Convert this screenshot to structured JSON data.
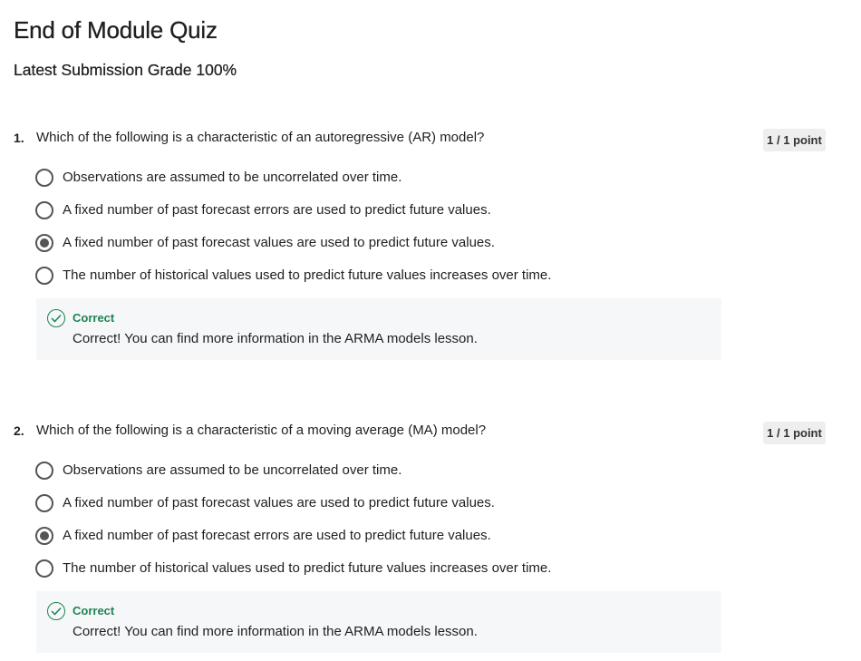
{
  "quiz": {
    "title": "End of Module Quiz",
    "grade": "Latest Submission Grade 100%"
  },
  "questions": [
    {
      "number": "1.",
      "text": "Which of the following is a characteristic of an autoregressive (AR) model?",
      "points": "1 / 1 point",
      "options": [
        {
          "label": "Observations are assumed to be uncorrelated over time.",
          "selected": false
        },
        {
          "label": "A fixed number of past forecast errors are used to predict future values.",
          "selected": false
        },
        {
          "label": "A fixed number of past forecast values are used to predict future values.",
          "selected": true
        },
        {
          "label": "The number of historical values used to predict future values increases over time.",
          "selected": false
        }
      ],
      "feedback": {
        "icon": "check-circle-icon",
        "title": "Correct",
        "text": "Correct! You can find more information in the ARMA models lesson."
      }
    },
    {
      "number": "2.",
      "text": "Which of the following is a characteristic of a moving average (MA) model?",
      "points": "1 / 1 point",
      "options": [
        {
          "label": "Observations are assumed to be uncorrelated over time.",
          "selected": false
        },
        {
          "label": "A fixed number of past forecast values are used to predict future values.",
          "selected": false
        },
        {
          "label": "A fixed number of past forecast errors are used to predict future values.",
          "selected": true
        },
        {
          "label": "The number of historical values used to predict future values increases over time.",
          "selected": false
        }
      ],
      "feedback": {
        "icon": "check-circle-icon",
        "title": "Correct",
        "text": "Correct! You can find more information in the ARMA models lesson."
      }
    }
  ],
  "colors": {
    "correct": "#1f8354",
    "feedback_bg": "#f5f7f8",
    "points_bg": "#eeeeee",
    "radio": "#555555"
  }
}
